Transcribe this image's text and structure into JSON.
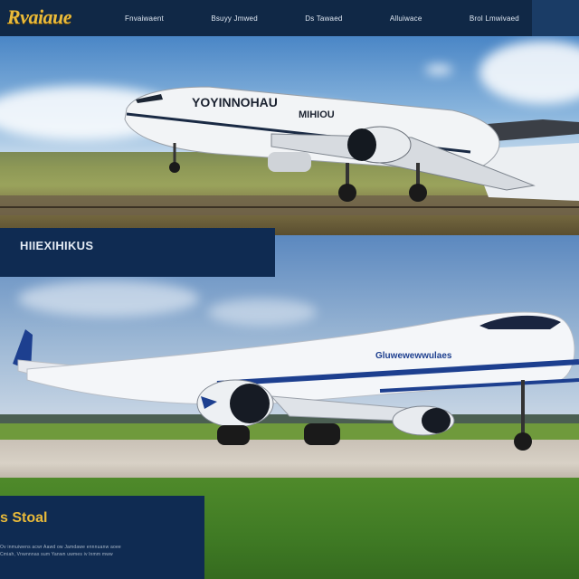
{
  "nav": {
    "logo": "Rvaiaue",
    "links": [
      "Fnvaiwaent",
      "Bsuyy Jmwed",
      "Ds Tawaed",
      "Alluiwace",
      "Brol Lmwivaed"
    ]
  },
  "hero1": {
    "fuselage_text_1": "YOYINNOHAU",
    "fuselage_text_2": "MIHIOU"
  },
  "banner": {
    "title": "HIIEXIHIKUS"
  },
  "hero2": {
    "fuselage_text": "Gluwewewwulaes"
  },
  "card": {
    "title": "s Stoal",
    "lines": [
      "Ov inmuiwens acwr Aawd ow Jamdawe ennnuanw aoee",
      "Cmiah, Vnwnnnas sum Yanwn uwmes iv lnmm mww"
    ]
  },
  "colors": {
    "nav_bg": "#102846",
    "logo_gold": "#e9bb3c",
    "banner_bg": "#0f2b52",
    "accent_blue": "#1d3f8f"
  }
}
